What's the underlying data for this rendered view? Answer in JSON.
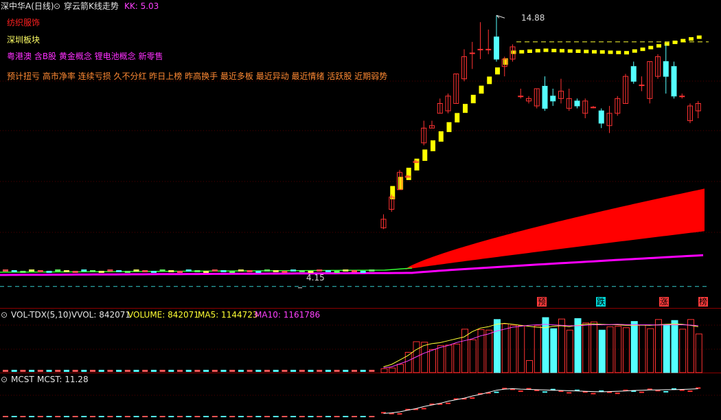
{
  "header": {
    "stock": "深中华A(日线)",
    "indicator_name": "穿云箭K线走势",
    "kk_label": "KK: 5.03"
  },
  "tags": {
    "industry": "纺织服饰",
    "region": "深圳板块",
    "concepts": "粤港澳 含B股 黄金概念 锂电池概念 新零售",
    "features": "预计扭亏 高市净率 连续亏损 久不分红 昨日上榜 昨高换手 最近多板 最近异动 最近情绪 活跃股 近期弱势"
  },
  "price_marks": {
    "high": "14.88",
    "low": "4.15"
  },
  "signals": [
    "预",
    "跌",
    "涨",
    "榜"
  ],
  "vol_panel": {
    "name": "VOL-TDX(5,10)",
    "vvol": "VVOL: 842071",
    "volume": "VOLUME: 842071",
    "ma5": "MA5: 1144723",
    "ma10": "MA10: 1161786"
  },
  "mcst_panel": {
    "name": "MCST",
    "value": "MCST: 11.28"
  },
  "colors": {
    "up": "#ff3232",
    "down": "#54ffff",
    "yellow": "#ffff00",
    "magenta": "#ff00ff",
    "divider": "#8b0000",
    "industry": "#ff2020",
    "region": "#ffff66",
    "concepts": "#ff30ff",
    "features": "#ff8a33"
  },
  "chart_data": {
    "type": "candlestick",
    "candles": [
      {
        "o": 6.25,
        "c": 6.6,
        "h": 6.8,
        "l": 6.2
      },
      {
        "o": 7.0,
        "c": 7.5,
        "h": 7.6,
        "l": 6.9
      },
      {
        "o": 7.8,
        "c": 8.5,
        "h": 8.6,
        "l": 7.8
      },
      {
        "o": 8.3,
        "c": 8.35,
        "h": 8.4,
        "l": 8.3
      },
      {
        "o": 8.9,
        "c": 8.95,
        "h": 9.0,
        "l": 8.9
      },
      {
        "o": 9.7,
        "c": 10.3,
        "h": 10.6,
        "l": 9.6
      },
      {
        "o": 10.3,
        "c": 10.4,
        "h": 10.6,
        "l": 10.3
      },
      {
        "o": 10.9,
        "c": 11.3,
        "h": 11.5,
        "l": 10.9
      },
      {
        "o": 11.0,
        "c": 11.6,
        "h": 11.7,
        "l": 10.9
      },
      {
        "o": 11.3,
        "c": 12.5,
        "h": 12.5,
        "l": 11.3
      },
      {
        "o": 12.3,
        "c": 13.2,
        "h": 13.5,
        "l": 12.2
      },
      {
        "o": 13.35,
        "c": 13.35,
        "h": 13.8,
        "l": 12.7
      },
      {
        "o": 13.5,
        "c": 13.5,
        "h": 14.6,
        "l": 13.1
      },
      {
        "o": 13.5,
        "c": 13.5,
        "h": 14.3,
        "l": 13.3
      },
      {
        "o": 14.0,
        "c": 13.1,
        "h": 14.88,
        "l": 13.0
      },
      {
        "o": 12.8,
        "c": 13.1,
        "h": 13.2,
        "l": 12.4
      },
      {
        "o": 13.1,
        "c": 13.6,
        "h": 13.7,
        "l": 13.0
      },
      {
        "o": 11.6,
        "c": 11.6,
        "h": 11.9,
        "l": 11.5
      },
      {
        "o": 11.4,
        "c": 11.5,
        "h": 11.6,
        "l": 11.3
      },
      {
        "o": 11.2,
        "c": 11.9,
        "h": 11.9,
        "l": 11.1
      },
      {
        "o": 12.0,
        "c": 11.1,
        "h": 12.4,
        "l": 11.0
      },
      {
        "o": 11.6,
        "c": 11.4,
        "h": 11.9,
        "l": 11.2
      },
      {
        "o": 11.5,
        "c": 11.8,
        "h": 12.3,
        "l": 11.3
      },
      {
        "o": 11.1,
        "c": 11.5,
        "h": 11.9,
        "l": 11.0
      },
      {
        "o": 11.4,
        "c": 11.2,
        "h": 11.5,
        "l": 11.1
      },
      {
        "o": 10.9,
        "c": 11.4,
        "h": 11.5,
        "l": 10.7
      },
      {
        "o": 11.15,
        "c": 11.15,
        "h": 11.2,
        "l": 11.1
      },
      {
        "o": 11.0,
        "c": 10.5,
        "h": 11.1,
        "l": 10.3
      },
      {
        "o": 10.4,
        "c": 10.9,
        "h": 11.2,
        "l": 10.1
      },
      {
        "o": 10.9,
        "c": 11.5,
        "h": 11.6,
        "l": 10.8
      },
      {
        "o": 11.3,
        "c": 12.4,
        "h": 12.5,
        "l": 11.3
      },
      {
        "o": 12.8,
        "c": 12.2,
        "h": 13.0,
        "l": 12.1
      },
      {
        "o": 12.05,
        "c": 12.05,
        "h": 12.4,
        "l": 11.8
      },
      {
        "o": 11.5,
        "c": 13.0,
        "h": 13.0,
        "l": 11.3
      },
      {
        "o": 12.4,
        "c": 13.2,
        "h": 13.3,
        "l": 12.3
      },
      {
        "o": 13.0,
        "c": 12.4,
        "h": 13.7,
        "l": 11.7
      },
      {
        "o": 12.8,
        "c": 11.6,
        "h": 13.0,
        "l": 11.5
      },
      {
        "o": 11.6,
        "c": 11.6,
        "h": 11.7,
        "l": 11.5
      },
      {
        "o": 10.6,
        "c": 11.2,
        "h": 11.3,
        "l": 10.5
      },
      {
        "o": 11.0,
        "c": 11.3,
        "h": 11.4,
        "l": 10.7
      }
    ],
    "volume": [
      80,
      95,
      170,
      420,
      640,
      630,
      480,
      560,
      570,
      590,
      900,
      680,
      890,
      880,
      1100,
      1010,
      980,
      970,
      250,
      970,
      1140,
      910,
      1110,
      880,
      1120,
      1030,
      1050,
      880,
      950,
      960,
      930,
      1060,
      990,
      910,
      1100,
      990,
      1080,
      900,
      1100,
      800
    ],
    "ma5": [
      120,
      170,
      260,
      350,
      470,
      560,
      600,
      620,
      660,
      700,
      740,
      850,
      920,
      950,
      1000,
      1020,
      1000,
      980,
      960,
      940,
      930,
      960,
      970,
      950,
      980,
      1000,
      1010,
      1000,
      995,
      990,
      980,
      980,
      985,
      980,
      990,
      1000,
      1010,
      1000,
      980,
      950
    ],
    "ma10": [
      100,
      120,
      180,
      240,
      320,
      400,
      460,
      520,
      560,
      620,
      660,
      700,
      760,
      800,
      860,
      900,
      940,
      960,
      980,
      990,
      1000,
      990,
      980,
      970,
      970,
      980,
      990,
      990,
      995,
      1000,
      995,
      990,
      990,
      990,
      985,
      990,
      990,
      990,
      985,
      970
    ],
    "mcst": [
      6.6,
      6.7,
      6.9,
      7.2,
      7.5,
      7.9,
      8.2,
      8.5,
      8.9,
      9.2,
      9.5,
      9.9,
      10.2,
      10.6,
      11.0,
      11.2,
      11.3,
      11.2,
      11.15,
      11.1,
      11.05,
      11.0,
      10.95,
      10.9,
      10.85,
      10.8,
      10.75,
      10.7,
      10.75,
      10.8,
      10.85,
      10.95,
      11.0,
      11.05,
      11.05,
      11.1,
      11.1,
      11.15,
      11.2,
      11.28
    ],
    "base_candles": 43,
    "price_range": [
      3.5,
      15.5
    ],
    "high_value": 14.88,
    "low_value": 4.15,
    "dashed_level_high": 13.8
  }
}
